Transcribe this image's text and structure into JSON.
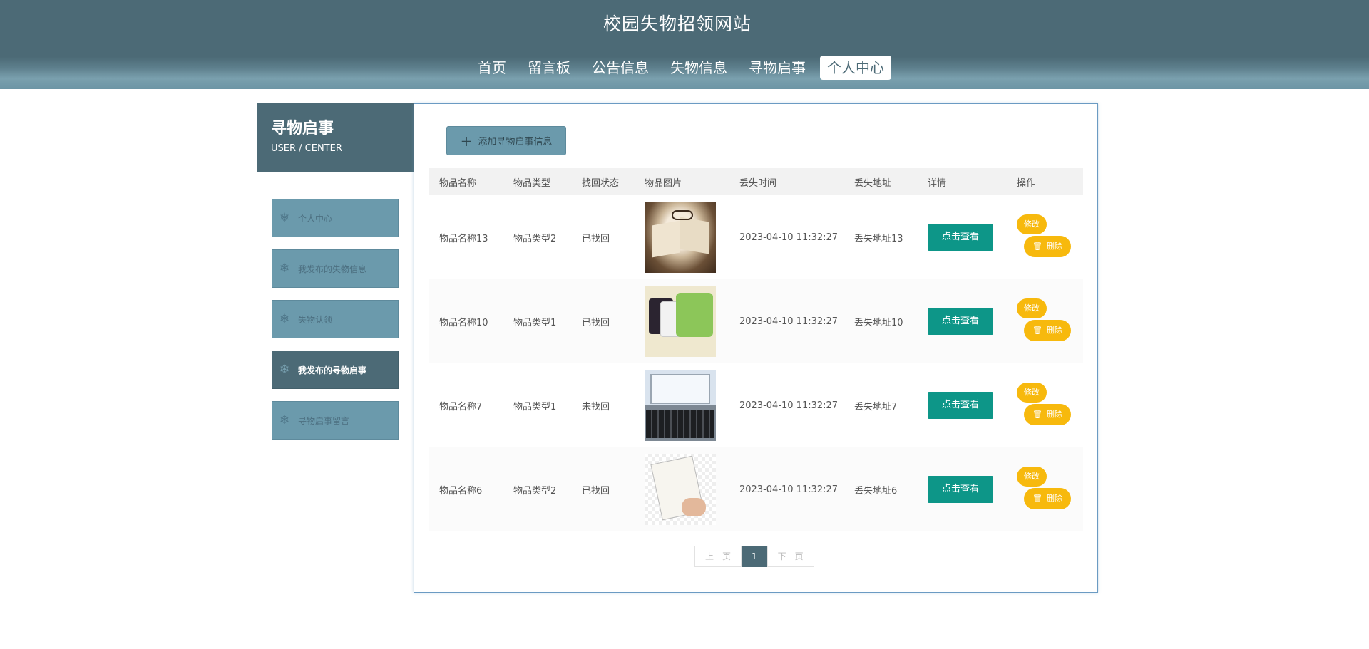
{
  "header": {
    "title": "校园失物招领网站",
    "nav": [
      "首页",
      "留言板",
      "公告信息",
      "失物信息",
      "寻物启事",
      "个人中心"
    ],
    "active_nav": 5
  },
  "sidebar": {
    "title": "寻物启事",
    "subtitle": "USER / CENTER",
    "items": [
      {
        "label": "个人中心",
        "icon": "snowflake-icon"
      },
      {
        "label": "我发布的失物信息",
        "icon": "snowflake-icon"
      },
      {
        "label": "失物认领",
        "icon": "snowflake-icon"
      },
      {
        "label": "我发布的寻物启事",
        "icon": "snowflake-icon"
      },
      {
        "label": "寻物启事留言",
        "icon": "snowflake-icon"
      }
    ],
    "active_index": 3
  },
  "toolbar": {
    "add_label": "添加寻物启事信息",
    "add_icon": "plus-icon"
  },
  "table": {
    "columns": [
      "物品名称",
      "物品类型",
      "找回状态",
      "物品图片",
      "丢失时间",
      "丢失地址",
      "详情",
      "操作"
    ],
    "rows": [
      {
        "name": "物品名称13",
        "type": "物品类型2",
        "status": "已找回",
        "image": "book-with-glasses",
        "time": "2023-04-10 11:32:27",
        "address": "丢失地址13"
      },
      {
        "name": "物品名称10",
        "type": "物品类型1",
        "status": "已找回",
        "image": "t-shirts",
        "time": "2023-04-10 11:32:27",
        "address": "丢失地址10"
      },
      {
        "name": "物品名称7",
        "type": "物品类型1",
        "status": "未找回",
        "image": "laptop",
        "time": "2023-04-10 11:32:27",
        "address": "丢失地址7"
      },
      {
        "name": "物品名称6",
        "type": "物品类型2",
        "status": "已找回",
        "image": "book-in-hand",
        "time": "2023-04-10 11:32:27",
        "address": "丢失地址6"
      }
    ],
    "view_label": "点击查看",
    "edit_label": "修改",
    "delete_label": "删除"
  },
  "pagination": {
    "prev": "上一页",
    "current": "1",
    "next": "下一页"
  },
  "colors": {
    "header": "#4c6a76",
    "menu": "#6b9aac",
    "view_button": "#0d9688",
    "action_button": "#f7b90d"
  }
}
